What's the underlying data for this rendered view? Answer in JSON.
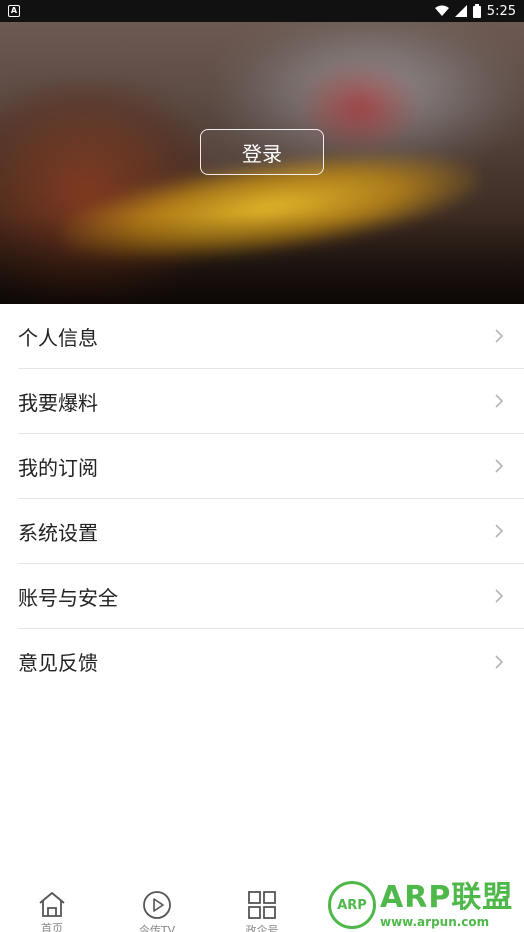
{
  "status_bar": {
    "left_icon": "A",
    "time": "5:25",
    "icons": [
      "wifi-icon",
      "signal-icon",
      "battery-icon"
    ]
  },
  "header": {
    "login_label": "登录"
  },
  "menu": {
    "items": [
      {
        "label": "个人信息"
      },
      {
        "label": "我要爆料"
      },
      {
        "label": "我的订阅"
      },
      {
        "label": "系统设置"
      },
      {
        "label": "账号与安全"
      },
      {
        "label": "意见反馈"
      }
    ]
  },
  "bottom_nav": {
    "items": [
      {
        "label": "首页",
        "icon": "home-icon"
      },
      {
        "label": "今传TV",
        "icon": "play-icon"
      },
      {
        "label": "政企号",
        "icon": "grid-icon"
      }
    ]
  },
  "watermark": {
    "badge": "ARP",
    "title": "ARP联盟",
    "url": "www.arpun.com",
    "color": "#4fb84a"
  }
}
